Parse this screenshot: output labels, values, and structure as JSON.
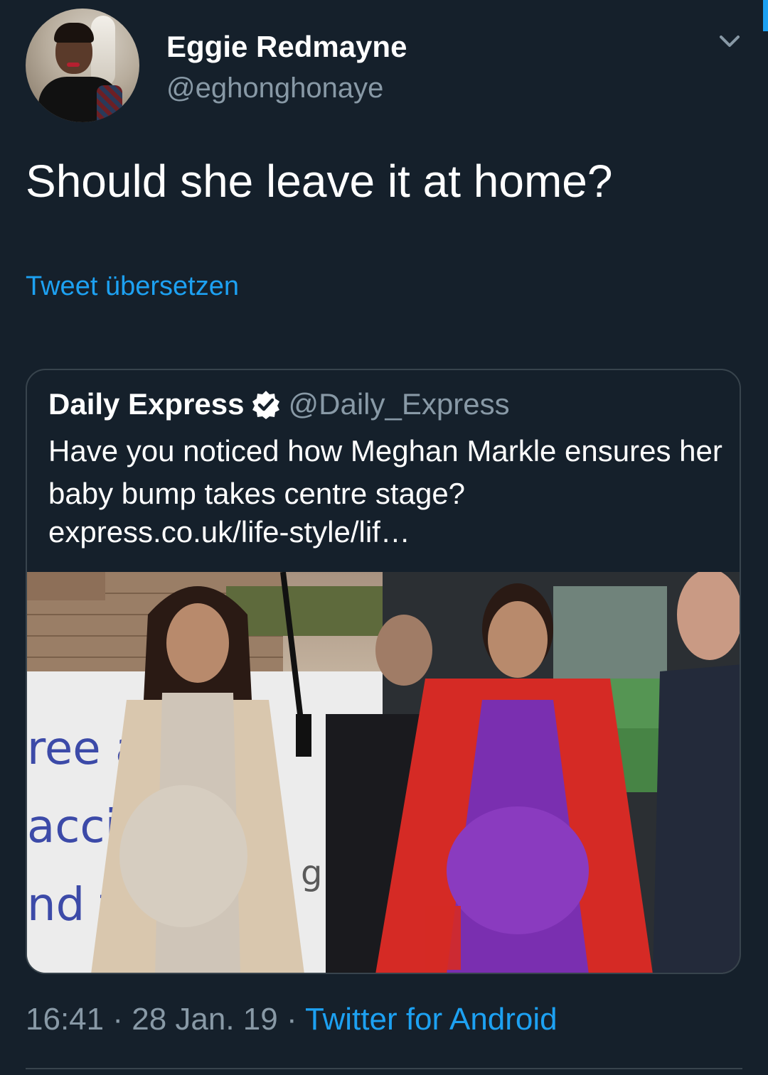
{
  "tweet": {
    "author_name": "Eggie Redmayne",
    "author_handle": "@eghonghonaye",
    "text": "Should she leave it at home?",
    "translate_label": "Tweet übersetzen",
    "time": "16:41",
    "separator1": " · ",
    "date": "28 Jan. 19",
    "separator2": " · ",
    "source": "Twitter for Android",
    "menu_icon": "chevron-down-icon"
  },
  "quoted_tweet": {
    "author_name": "Daily Express",
    "verified_icon": "verified-badge-icon",
    "author_handle": "@Daily_Express",
    "text": "Have you noticed how Meghan Markle ensures her baby bump takes centre stage?",
    "link": "express.co.uk/life-style/lif…",
    "image_signage": {
      "line1": "ree ar",
      "line2": "accin",
      "line3": "nd fl",
      "fragment": "g"
    }
  },
  "colors": {
    "background": "#15202b",
    "accent": "#1da1f2",
    "secondary_text": "#8899a6",
    "border": "#38444d"
  }
}
